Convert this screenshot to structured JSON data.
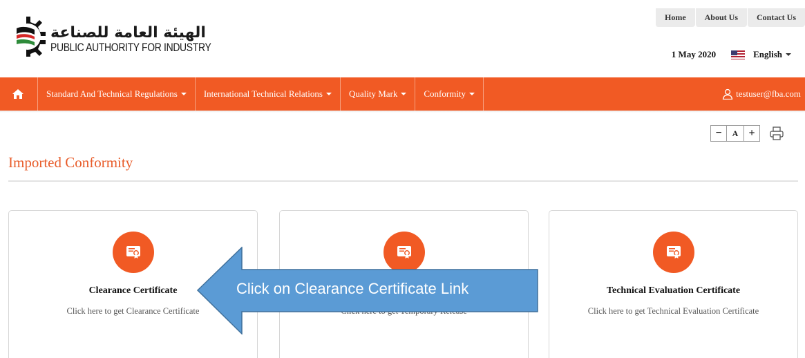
{
  "header": {
    "logo_ar": "الهيئة العامة للصناعة",
    "logo_en": "PUBLIC AUTHORITY FOR INDUSTRY",
    "top_links": [
      "Home",
      "About Us",
      "Contact Us"
    ],
    "date": "1 May 2020",
    "language": "English"
  },
  "nav": {
    "home_icon": "home-icon",
    "items": [
      "Standard And Technical Regulations",
      "International Technical Relations",
      "Quality Mark",
      "Conformity"
    ],
    "user": "testuser@fba.com"
  },
  "tools": {
    "decrease": "−",
    "font": "A",
    "increase": "+",
    "print_icon": "printer-icon"
  },
  "page": {
    "title": "Imported Conformity"
  },
  "cards": [
    {
      "title": "Clearance Certificate",
      "desc": "Click here to get Clearance Certificate",
      "icon": "certificate-icon"
    },
    {
      "title": "",
      "desc": "Click here to get Temporary Release",
      "icon": "certificate-icon"
    },
    {
      "title": "Technical Evaluation Certificate",
      "desc": "Click here to get Technical Evaluation Certificate",
      "icon": "certificate-icon"
    }
  ],
  "callout": {
    "text": "Click on Clearance Certificate Link"
  },
  "colors": {
    "brand": "#f15a24",
    "title": "#e85c2a",
    "callout": "#5b9bd5"
  }
}
